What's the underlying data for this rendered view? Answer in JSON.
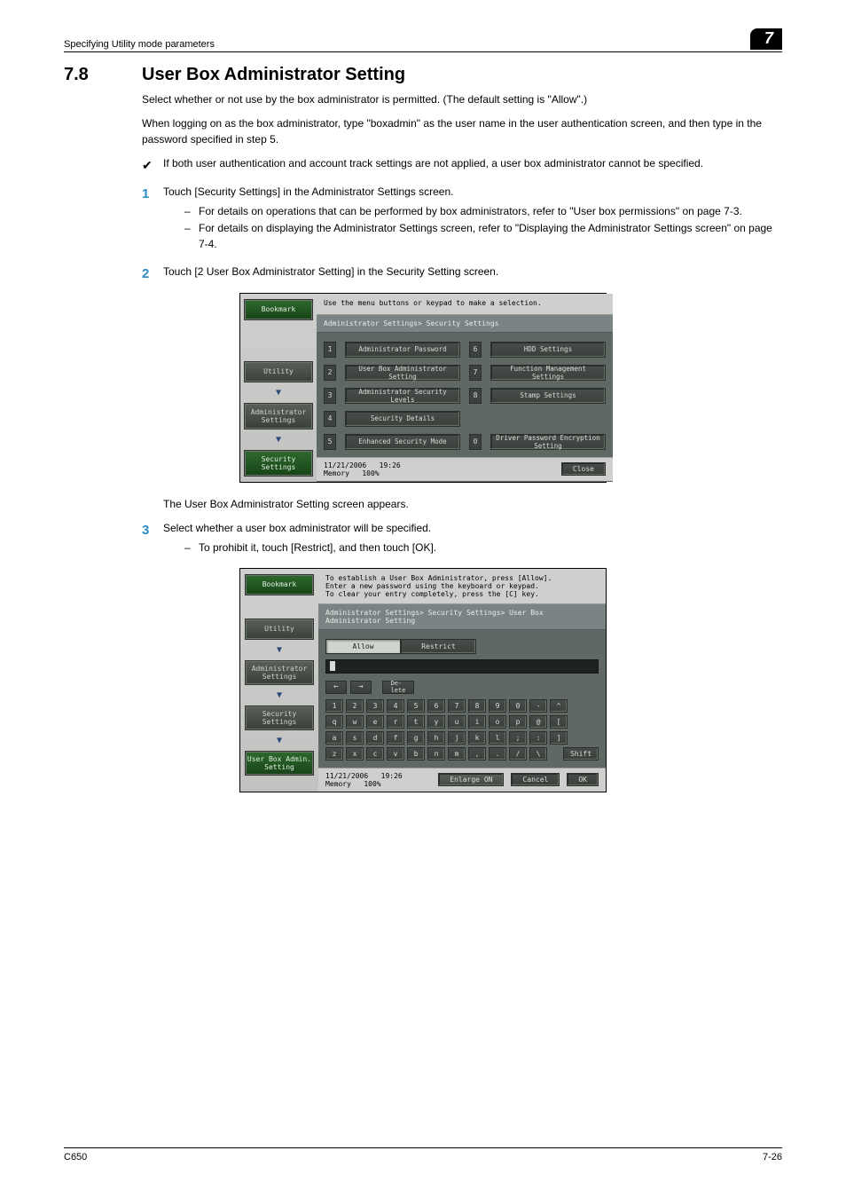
{
  "header": {
    "running_head": "Specifying Utility mode parameters",
    "chapter": "7"
  },
  "section": {
    "number": "7.8",
    "title": "User Box Administrator Setting"
  },
  "intro": {
    "p1": "Select whether or not use by the box administrator is permitted. (The default setting is \"Allow\".)",
    "p2": "When logging on as the box administrator, type \"boxadmin\" as the user name in the user authentication screen, and then type in the password specified in step 5.",
    "check": "If both user authentication and account track settings are not applied, a user box administrator cannot be specified."
  },
  "steps": {
    "s1": {
      "text": "Touch [Security Settings] in the Administrator Settings screen.",
      "subs": [
        "For details on operations that can be performed by box administrators, refer to \"User box permissions\" on page 7-3.",
        "For details on displaying the Administrator Settings screen, refer to \"Displaying the Administrator Settings screen\" on page 7-4."
      ]
    },
    "s2": {
      "text": "Touch [2 User Box Administrator Setting] in the Security Setting screen."
    },
    "after2": "The User Box Administrator Setting screen appears.",
    "s3": {
      "text": "Select whether a user box administrator will be specified.",
      "subs": [
        "To prohibit it, touch [Restrict], and then touch [OK]."
      ]
    }
  },
  "panel1": {
    "instruction": "Use the menu buttons or keypad to make a selection.",
    "breadcrumb": "Administrator Settings> Security Settings",
    "side": {
      "bookmark": "Bookmark",
      "utility": "Utility",
      "admin": "Administrator Settings",
      "security": "Security Settings"
    },
    "menu": {
      "i1": "Administrator Password",
      "i2": "User Box Administrator Setting",
      "i3": "Administrator Security Levels",
      "i4": "Security Details",
      "i5": "Enhanced Security Mode",
      "i6": "HDD Settings",
      "i7": "Function Management Settings",
      "i8": "Stamp Settings",
      "i0": "Driver Password Encryption Setting"
    },
    "foot": {
      "date": "11/21/2006",
      "time": "19:26",
      "mem_label": "Memory",
      "mem_val": "100%",
      "close": "Close"
    }
  },
  "panel2": {
    "instruction": "To establish a User Box Administrator, press [Allow].\nEnter a new password using the keyboard or keypad.\nTo clear your entry completely, press the [C] key.",
    "breadcrumb": "Administrator Settings> Security Settings> User Box Administrator Setting",
    "side": {
      "bookmark": "Bookmark",
      "utility": "Utility",
      "admin": "Administrator Settings",
      "security": "Security Settings",
      "userbox": "User Box Admin. Setting"
    },
    "toggle": {
      "allow": "Allow",
      "restrict": "Restrict"
    },
    "delete_key": "De-\nlete",
    "kb": {
      "r1": [
        "1",
        "2",
        "3",
        "4",
        "5",
        "6",
        "7",
        "8",
        "9",
        "0",
        "-",
        "^"
      ],
      "r2": [
        "q",
        "w",
        "e",
        "r",
        "t",
        "y",
        "u",
        "i",
        "o",
        "p",
        "@",
        "["
      ],
      "r3": [
        "a",
        "s",
        "d",
        "f",
        "g",
        "h",
        "j",
        "k",
        "l",
        ";",
        ":",
        "]"
      ],
      "r4": [
        "z",
        "x",
        "c",
        "v",
        "b",
        "n",
        "m",
        ",",
        ".",
        "/",
        "\\"
      ],
      "shift": "Shift"
    },
    "foot": {
      "date": "11/21/2006",
      "time": "19:26",
      "mem_label": "Memory",
      "mem_val": "100%",
      "enlarge": "Enlarge ON",
      "cancel": "Cancel",
      "ok": "OK"
    }
  },
  "footer": {
    "left": "C650",
    "right": "7-26"
  }
}
